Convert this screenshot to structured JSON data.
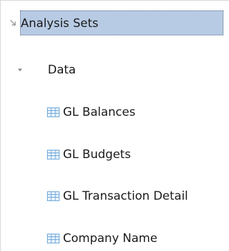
{
  "tree": {
    "root": {
      "label": "Analysis Sets",
      "toggle_icon": "collapse-arrow-icon"
    },
    "data_group": {
      "label": "Data",
      "toggle_icon": "expanded-triangle-icon"
    },
    "items": [
      {
        "label": "GL Balances",
        "icon": "table-grid-icon"
      },
      {
        "label": "GL Budgets",
        "icon": "table-grid-icon"
      },
      {
        "label": "GL Transaction Detail",
        "icon": "table-grid-icon"
      },
      {
        "label": "Company Name",
        "icon": "table-grid-icon"
      }
    ]
  },
  "colors": {
    "selection_fill": "#b8cbe4",
    "grid_icon": "#6fa8d8",
    "toggle": "#8a8a8a"
  }
}
